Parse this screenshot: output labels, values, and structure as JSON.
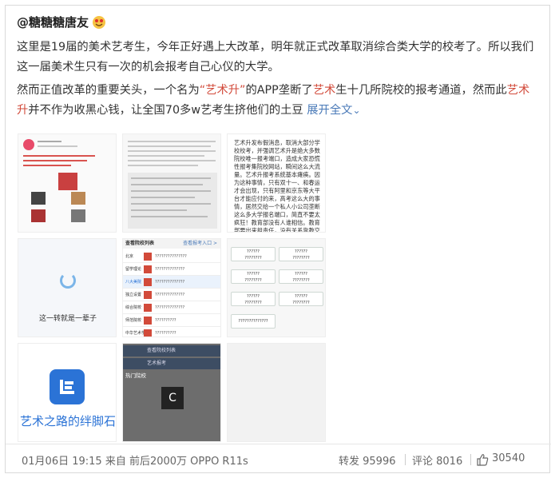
{
  "post": {
    "username": "@糖糖糖唐友",
    "paragraphs": [
      {
        "text": "这里是19届的美术艺考生，今年正好遇上大改革，明年就正式改革取消综合类大学的校考了。所以我们这一届美术生只有一次的机会报考自己心仪的大学。"
      },
      {
        "pre": "然而正值改革的重要关头，一个名为",
        "hl1": "“艺术升”",
        "mid1": "的APP垄断了",
        "hl2": "艺术",
        "mid2": "生十几所院校的报考通道，然而此",
        "hl3": "艺术升",
        "post": "并不作为收黑心钱，让全国70多w艺考生挤他们的土豆",
        "expand": "展开全文"
      }
    ]
  },
  "images": {
    "t3_text": "艺术升发布假消息，取消大部分学校校考，并强调艺术升是绝大多数院校唯一报考端口，造成大家恐慌性报考集院校网站，瞬间这么大流量。艺术升报考系统基本瘫痪。因为这种事情，只有双十一、和春运才会出现，只有阿里和京东等大平台才能应付的来，高考这么大的事情，居然交给一个私人小公司垄断这么多大学报名端口，简直不要太疯狂！教育部没有人谁相信。教育部要出来担责任，没有关系靠教交委谁相信！",
    "t4_text": "这一转就是一辈子",
    "t5_header": "查看院校列表",
    "t5_header_link": "查看报考入口 >",
    "t5_rows": [
      {
        "side": "北京",
        "q": "???????????????"
      },
      {
        "side": "留学理论",
        "q": "??????????????"
      },
      {
        "side": "八大美院",
        "q": "??????????????"
      },
      {
        "side": "独立设置",
        "q": "??????????????"
      },
      {
        "side": "综合院校",
        "q": "??????????????"
      },
      {
        "side": "师范院校",
        "q": "??????????"
      },
      {
        "side": "中华艺术学院",
        "q": "??????????"
      },
      {
        "side": "北京市",
        "q": "??????????"
      }
    ],
    "t6_buttons": [
      {
        "line1": "??????",
        "line2": "????????"
      },
      {
        "line1": "??????",
        "line2": "????????"
      },
      {
        "line1": "??????",
        "line2": "????????"
      },
      {
        "line1": "??????",
        "line2": "????????"
      },
      {
        "line1": "??????",
        "line2": "????????"
      },
      {
        "line1": "??????",
        "line2": "????????"
      },
      {
        "line1": "??????????????",
        "line2": ""
      }
    ],
    "t7_text": "艺术之路的绊脚石",
    "t8_bar1": "查看院校列表",
    "t8_bar2": "艺术报考",
    "t8_label": "热门院校",
    "t8_glyph": "C"
  },
  "footer": {
    "meta": "01月06日 19:15 来自 前后2000万 OPPO R11s",
    "repost": "转发 95996",
    "comment": "评论 8016",
    "likes": "30540"
  },
  "colors": {
    "highlight": "#d24a3a",
    "link": "#4a7ab8",
    "brand": "#2b73d6"
  }
}
